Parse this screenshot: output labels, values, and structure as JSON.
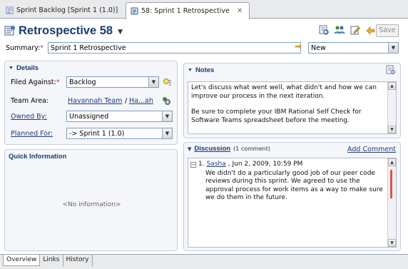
{
  "tabs": [
    {
      "label": "Sprint Backlog [Sprint 1 (1.0)]",
      "active": false
    },
    {
      "label": "58: Sprint 1 Retrospective",
      "active": true
    }
  ],
  "header": {
    "title": "Retrospective 58",
    "save_label": "Save"
  },
  "summary": {
    "label": "Summary:",
    "required_marker": "*",
    "value": "Sprint 1 Retrospective",
    "state": "New"
  },
  "details": {
    "title": "Details",
    "filed_against_label": "Filed Against:",
    "filed_against_value": "Backlog",
    "team_area_label": "Team Area:",
    "team_area_value": "Havannah Team",
    "team_area_sep": "/",
    "team_area_path": "Ha...ah",
    "owned_by_label": "Owned By:",
    "owned_by_value": "Unassigned",
    "planned_for_label": "Planned For:",
    "planned_for_value": "-> Sprint 1 (1.0)"
  },
  "quick_info": {
    "title": "Quick Information",
    "empty_text": "<No information>"
  },
  "notes": {
    "title": "Notes",
    "paragraph1": "Let's discuss what went well, what didn't and how we can improve our process in the next iteration.",
    "paragraph2": "Be sure to complete your IBM Rational Self Check for Software Teams spreadsheet before the meeting."
  },
  "discussion": {
    "title": "Discussion",
    "count": "(1 comment)",
    "add_label": "Add Comment",
    "comments": [
      {
        "index": "1.",
        "author": "Sasha",
        "date": ", Jun 2, 2009, 10:59 PM",
        "text": "We didn't do a particularly good job of our peer code reviews during this sprint.  We agreed to use the approval process for work items as a way to make sure we do them in the future."
      }
    ]
  },
  "bottom_tabs": [
    "Overview",
    "Links",
    "History"
  ],
  "colors": {
    "title": "#1b3d6e",
    "link": "#1e3c7a",
    "section_bg": "#f4f6fa",
    "required": "#cc3333"
  }
}
